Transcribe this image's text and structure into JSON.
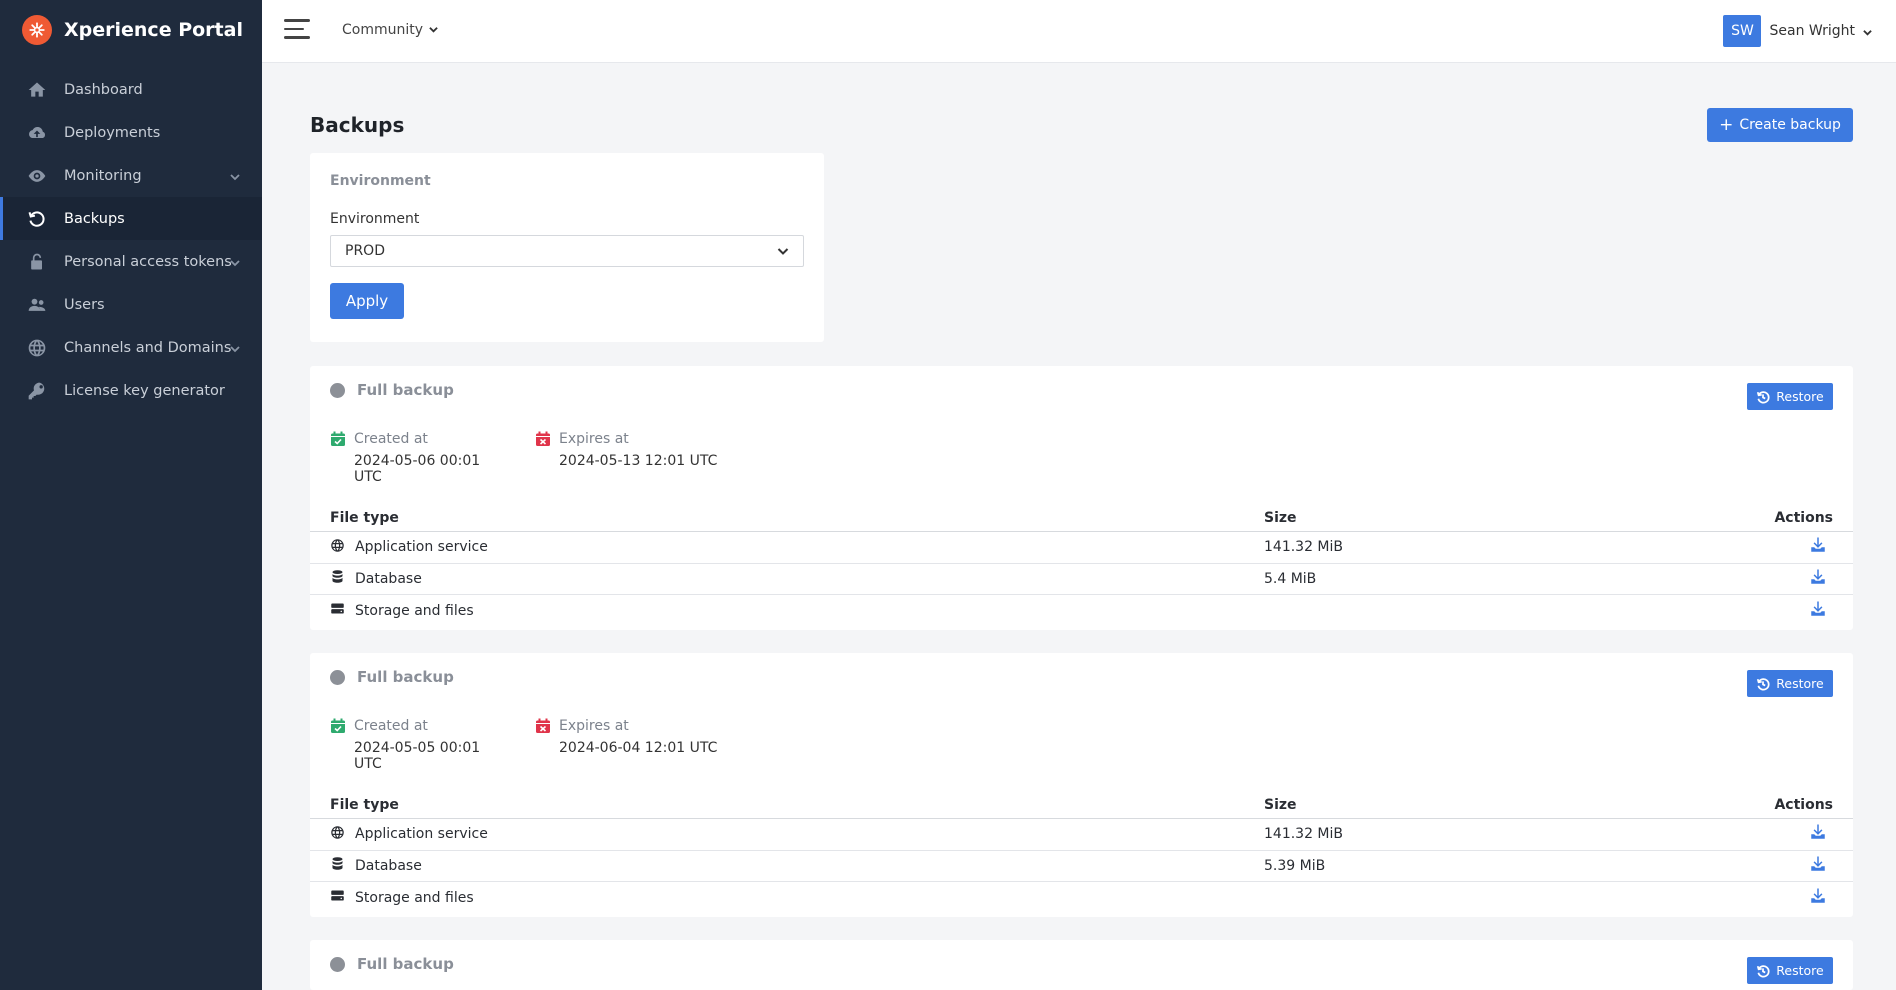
{
  "brand": {
    "title": "Xperience Portal",
    "logo_icon": "kentico-logo-icon",
    "logo_color": "#ef5a34"
  },
  "sidebar": {
    "items": [
      {
        "label": "Dashboard",
        "icon": "home-icon",
        "has_chevron": false,
        "active": false
      },
      {
        "label": "Deployments",
        "icon": "cloud-upload-icon",
        "has_chevron": false,
        "active": false
      },
      {
        "label": "Monitoring",
        "icon": "eye-icon",
        "has_chevron": true,
        "active": false
      },
      {
        "label": "Backups",
        "icon": "restore-icon",
        "has_chevron": false,
        "active": true
      },
      {
        "label": "Personal access tokens",
        "icon": "lock-open-icon",
        "has_chevron": true,
        "active": false
      },
      {
        "label": "Users",
        "icon": "users-icon",
        "has_chevron": false,
        "active": false
      },
      {
        "label": "Channels and Domains",
        "icon": "globe-icon",
        "has_chevron": true,
        "active": false
      },
      {
        "label": "License key generator",
        "icon": "key-icon",
        "has_chevron": false,
        "active": false
      }
    ]
  },
  "topbar": {
    "project": "Community",
    "user": {
      "initials": "SW",
      "name": "Sean Wright"
    }
  },
  "page": {
    "title": "Backups",
    "create_button": "Create backup"
  },
  "filter": {
    "heading": "Environment",
    "field_label": "Environment",
    "selected": "PROD",
    "apply_label": "Apply"
  },
  "backups": [
    {
      "title": "Full backup",
      "restore_label": "Restore",
      "created_label": "Created at",
      "created_value": "2024-05-06 00:01 UTC",
      "expires_label": "Expires at",
      "expires_value": "2024-05-13 12:01 UTC",
      "columns": [
        "File type",
        "Size",
        "Actions"
      ],
      "files": [
        {
          "type": "Application service",
          "icon": "globe-icon",
          "size": "141.32 MiB"
        },
        {
          "type": "Database",
          "icon": "database-icon",
          "size": "5.4 MiB"
        },
        {
          "type": "Storage and files",
          "icon": "hdd-icon",
          "size": ""
        }
      ]
    },
    {
      "title": "Full backup",
      "restore_label": "Restore",
      "created_label": "Created at",
      "created_value": "2024-05-05 00:01 UTC",
      "expires_label": "Expires at",
      "expires_value": "2024-06-04 12:01 UTC",
      "columns": [
        "File type",
        "Size",
        "Actions"
      ],
      "files": [
        {
          "type": "Application service",
          "icon": "globe-icon",
          "size": "141.32 MiB"
        },
        {
          "type": "Database",
          "icon": "database-icon",
          "size": "5.39 MiB"
        },
        {
          "type": "Storage and files",
          "icon": "hdd-icon",
          "size": ""
        }
      ]
    },
    {
      "title": "Full backup",
      "restore_label": "Restore"
    }
  ],
  "colors": {
    "accent": "#3d7ae0",
    "sidebar_bg": "#1f2b3d",
    "created_icon": "#2eaa6e",
    "expires_icon": "#e0344a"
  }
}
